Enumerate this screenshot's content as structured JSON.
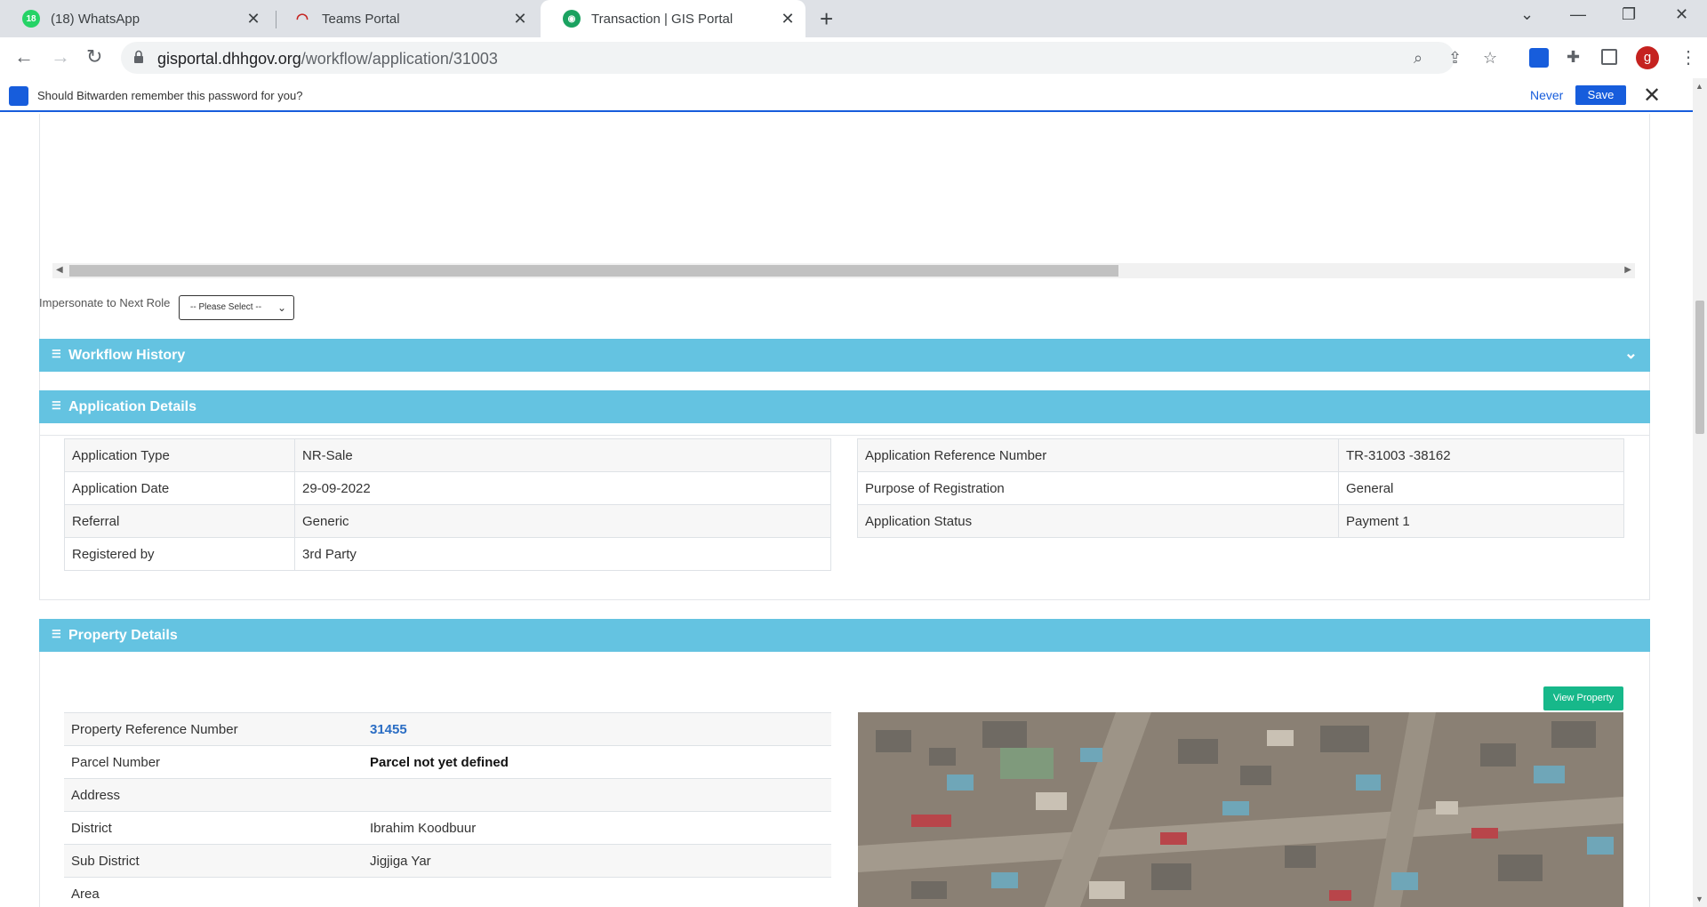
{
  "browser": {
    "tabs": [
      {
        "title": "(18) WhatsApp",
        "badge": "18"
      },
      {
        "title": "Teams Portal"
      },
      {
        "title": "Transaction | GIS Portal",
        "active": true
      }
    ],
    "url_domain": "gisportal.dhhgov.org",
    "url_path": "/workflow/application/31003",
    "avatar_letter": "g"
  },
  "bitwarden": {
    "prompt": "Should Bitwarden remember this password for you?",
    "never_label": "Never",
    "save_label": "Save"
  },
  "workflow": {
    "impersonate_label": "Impersonate to Next Role",
    "impersonate_value": "-- Please Select --"
  },
  "sections": {
    "workflow_history": "Workflow History",
    "application_details": "Application Details",
    "property_details": "Property Details"
  },
  "application": {
    "left": [
      {
        "label": "Application Type",
        "value": "NR-Sale"
      },
      {
        "label": "Application Date",
        "value": "29-09-2022"
      },
      {
        "label": "Referral",
        "value": "Generic"
      },
      {
        "label": "Registered by",
        "value": "3rd Party"
      }
    ],
    "right": [
      {
        "label": "Application Reference Number",
        "value": "TR-31003 -38162"
      },
      {
        "label": "Purpose of Registration",
        "value": "General"
      },
      {
        "label": "Application Status",
        "value": "Payment 1"
      }
    ]
  },
  "property": {
    "view_button": "View Property",
    "rows": [
      {
        "label": "Property Reference Number",
        "value": "31455"
      },
      {
        "label": "Parcel Number",
        "value": "Parcel not yet defined"
      },
      {
        "label": "Address",
        "value": ""
      },
      {
        "label": "District",
        "value": "Ibrahim Koodbuur"
      },
      {
        "label": "Sub District",
        "value": "Jigjiga Yar"
      },
      {
        "label": "Area",
        "value": ""
      }
    ]
  },
  "colors": {
    "panel_header": "#64c3e1",
    "view_button": "#17b88a",
    "bitwarden_blue": "#175ddc",
    "link_blue": "#2a6dc4"
  }
}
